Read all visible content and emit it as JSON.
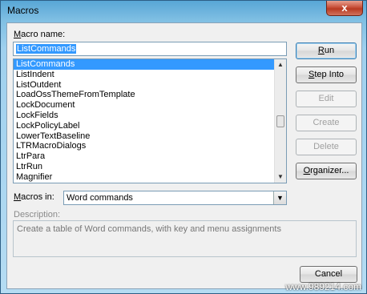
{
  "window": {
    "title": "Macros",
    "close_glyph": "x"
  },
  "macro_name": {
    "label": "Macro name:",
    "value": "ListCommands"
  },
  "macros_list": {
    "items": [
      "ListCommands",
      "ListIndent",
      "ListOutdent",
      "LoadOssThemeFromTemplate",
      "LockDocument",
      "LockFields",
      "LockPolicyLabel",
      "LowerTextBaseline",
      "LTRMacroDialogs",
      "LtrPara",
      "LtrRun",
      "Magnifier"
    ],
    "selected_index": 0,
    "scroll_position": 0.5
  },
  "buttons": {
    "run": "Run",
    "step_into": "Step Into",
    "edit": "Edit",
    "create": "Create",
    "delete": "Delete",
    "organizer": "Organizer...",
    "cancel": "Cancel"
  },
  "macros_in": {
    "label": "Macros in:",
    "value": "Word commands"
  },
  "description": {
    "label": "Description:",
    "text": "Create a table of Word commands, with key and menu assignments"
  },
  "watermark": "www.989214.com",
  "icons": {
    "close": "close-icon",
    "scroll_up": "triangle-up",
    "scroll_down": "triangle-down",
    "dropdown": "triangle-down"
  }
}
